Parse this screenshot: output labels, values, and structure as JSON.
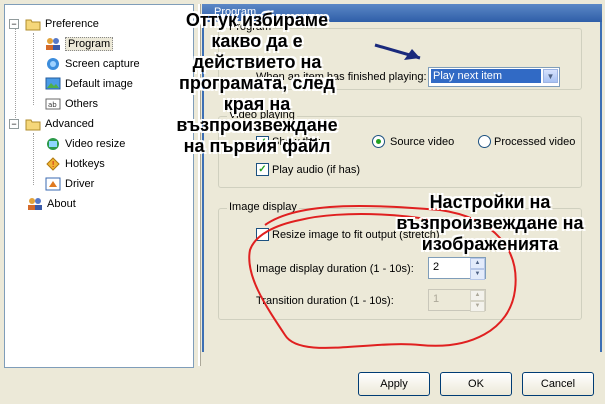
{
  "tree": {
    "preference": "Preference",
    "program": "Program",
    "screen_capture": "Screen capture",
    "default_image": "Default image",
    "others": "Others",
    "advanced": "Advanced",
    "video_resize": "Video resize",
    "hotkeys": "Hotkeys",
    "driver": "Driver",
    "about": "About"
  },
  "panel": {
    "title": "Program",
    "program_group": "Program",
    "finished_label": "When an item has finished playing:",
    "finished_value": "Play next item",
    "video_group": "Video playing",
    "show_label": "Show the:",
    "source_video": "Source video",
    "processed_video": "Processed video",
    "play_audio": "Play audio (if has)",
    "image_group": "Image display",
    "resize_image": "Resize image to fit output (stretch)",
    "image_duration_label": "Image display duration (1 - 10s):",
    "image_duration_value": "2",
    "transition_label": "Transition duration (1 - 10s):",
    "transition_value": "1"
  },
  "buttons": {
    "apply": "Apply",
    "ok": "OK",
    "cancel": "Cancel"
  },
  "annotations": {
    "top": "Оттук избираме какво да е действието на програмата, след края на възпроизвеждане на първия файл",
    "bottom": "Настройки на възпроизвеждане на изображенията"
  }
}
